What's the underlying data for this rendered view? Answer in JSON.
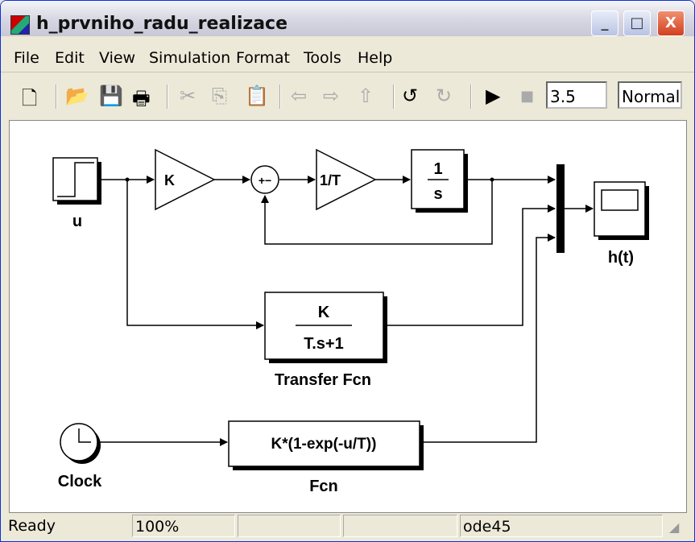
{
  "window": {
    "title": "h_prvniho_radu_realizace",
    "minimize": "_",
    "maximize": "□",
    "close": "X"
  },
  "menu": [
    "File",
    "Edit",
    "View",
    "Simulation",
    "Format",
    "Tools",
    "Help"
  ],
  "toolbar": {
    "stop_time": "3.5",
    "sim_mode": "Normal",
    "icons": [
      "new-icon",
      "open-icon",
      "save-icon",
      "print-icon",
      "cut-icon",
      "copy-icon",
      "paste-icon",
      "back-icon",
      "forward-icon",
      "up-icon",
      "undo-icon",
      "redo-icon",
      "play-icon",
      "stop-icon"
    ]
  },
  "diagram": {
    "step_label": "u",
    "gain1": "K",
    "sum_signs": "+−",
    "gain2": "1/T",
    "integrator_num": "1",
    "integrator_den": "s",
    "tf_num": "K",
    "tf_den": "T.s+1",
    "tf_label": "Transfer Fcn",
    "clock_label": "Clock",
    "fcn_expr": "K*(1-exp(-u/T))",
    "fcn_label": "Fcn",
    "scope_label": "h(t)"
  },
  "status": {
    "state": "Ready",
    "zoom": "100%",
    "cell3": "",
    "cell4": "",
    "solver": "ode45"
  }
}
